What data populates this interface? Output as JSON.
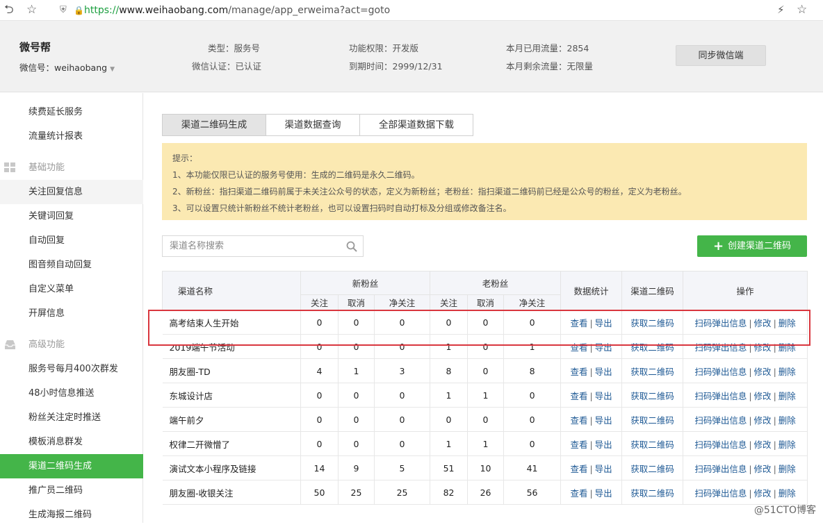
{
  "browser": {
    "url_scheme": "https://",
    "url_host": "www.weihaobang.com",
    "url_path": "/manage/app_erweima?act=goto"
  },
  "header": {
    "brand": "微号帮",
    "wechat_id": "微信号：weihaobang",
    "type": "类型：服务号",
    "verify": "微信认证：已认证",
    "permission": "功能权限：开发版",
    "expire": "到期时间：2999/12/31",
    "used_traffic": "本月已用流量：2854",
    "remain_traffic": "本月剩余流量：无限量",
    "sync_label": "同步微信端"
  },
  "sidebar": {
    "items": [
      {
        "label": "续费延长服务"
      },
      {
        "label": "流量统计报表"
      },
      {
        "label": "基础功能"
      },
      {
        "label": "关注回复信息"
      },
      {
        "label": "关键词回复"
      },
      {
        "label": "自动回复"
      },
      {
        "label": "图音频自动回复"
      },
      {
        "label": "自定义菜单"
      },
      {
        "label": "开屏信息"
      },
      {
        "label": "高级功能"
      },
      {
        "label": "服务号每月400次群发"
      },
      {
        "label": "48小时信息推送"
      },
      {
        "label": "粉丝关注定时推送"
      },
      {
        "label": "模板消息群发"
      },
      {
        "label": "渠道二维码生成"
      },
      {
        "label": "推广员二维码"
      },
      {
        "label": "生成海报二维码"
      }
    ]
  },
  "tabs": [
    {
      "label": "渠道二维码生成"
    },
    {
      "label": "渠道数据查询"
    },
    {
      "label": "全部渠道数据下载"
    }
  ],
  "notice": {
    "title": "提示：",
    "line1": "1、本功能仅限已认证的服务号使用：生成的二维码是永久二维码。",
    "line2": "2、新粉丝：指扫渠道二维码前属于未关注公众号的状态，定义为新粉丝；老粉丝：指扫渠道二维码前已经是公众号的粉丝，定义为老粉丝。",
    "line3": "3、可以设置只统计新粉丝不统计老粉丝，也可以设置扫码时自动打标及分组或修改备注名。"
  },
  "search": {
    "placeholder": "渠道名称搜索"
  },
  "create_label": "创建渠道二维码",
  "table": {
    "headers": {
      "name": "渠道名称",
      "new_fans": "新粉丝",
      "old_fans": "老粉丝",
      "follow": "关注",
      "cancel": "取消",
      "net": "净关注",
      "stats": "数据统计",
      "qrcode": "渠道二维码",
      "ops": "操作"
    },
    "links": {
      "view": "查看",
      "export": "导出",
      "get_qr": "获取二维码",
      "popup": "扫码弹出信息",
      "edit": "修改",
      "delete": "删除"
    },
    "rows": [
      {
        "name": "高考结束人生开始",
        "n1": "0",
        "n2": "0",
        "n3": "0",
        "o1": "0",
        "o2": "0",
        "o3": "0"
      },
      {
        "name": "2019端午节活动",
        "n1": "0",
        "n2": "0",
        "n3": "0",
        "o1": "1",
        "o2": "0",
        "o3": "1"
      },
      {
        "name": "朋友圈-TD",
        "n1": "4",
        "n2": "1",
        "n3": "3",
        "o1": "8",
        "o2": "0",
        "o3": "8"
      },
      {
        "name": "东城设计店",
        "n1": "0",
        "n2": "0",
        "n3": "0",
        "o1": "1",
        "o2": "1",
        "o3": "0"
      },
      {
        "name": "端午前夕",
        "n1": "0",
        "n2": "0",
        "n3": "0",
        "o1": "0",
        "o2": "0",
        "o3": "0"
      },
      {
        "name": "权律二开微憎了",
        "n1": "0",
        "n2": "0",
        "n3": "0",
        "o1": "1",
        "o2": "1",
        "o3": "0"
      },
      {
        "name": "演试文本小程序及链接",
        "n1": "14",
        "n2": "9",
        "n3": "5",
        "o1": "51",
        "o2": "10",
        "o3": "41"
      },
      {
        "name": "朋友圈-收银关注",
        "n1": "50",
        "n2": "25",
        "n3": "25",
        "o1": "82",
        "o2": "26",
        "o3": "56"
      }
    ]
  },
  "watermark": "@51CTO博客"
}
